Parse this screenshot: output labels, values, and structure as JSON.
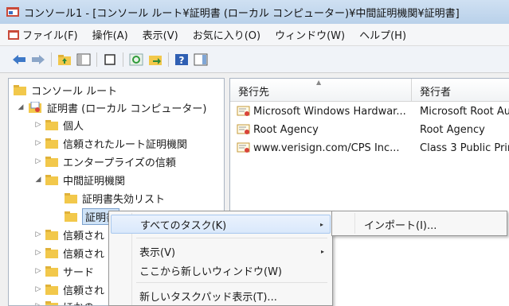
{
  "window": {
    "title": "コンソール1 - [コンソール ルート¥証明書 (ローカル コンピューター)¥中間証明機関¥証明書]"
  },
  "menubar": {
    "items": [
      "ファイル(F)",
      "操作(A)",
      "表示(V)",
      "お気に入り(O)",
      "ウィンドウ(W)",
      "ヘルプ(H)"
    ]
  },
  "toolbar": {
    "icons": [
      "back-arrow-icon",
      "forward-arrow-icon",
      "up-folder-icon",
      "show-hide-tree-icon",
      "new-window-icon",
      "refresh-icon",
      "export-list-icon",
      "help-icon",
      "action-pane-icon"
    ]
  },
  "tree": {
    "items": [
      {
        "label": "コンソール ルート"
      },
      {
        "label": "証明書 (ローカル コンピューター)"
      },
      {
        "label": "個人"
      },
      {
        "label": "信頼されたルート証明機関"
      },
      {
        "label": "エンタープライズの信頼"
      },
      {
        "label": "中間証明機関"
      },
      {
        "label": "証明書失効リスト"
      },
      {
        "label": "証明書"
      },
      {
        "label": "信頼され"
      },
      {
        "label": "信頼され"
      },
      {
        "label": "サード"
      },
      {
        "label": "信頼され"
      },
      {
        "label": "ほかの"
      }
    ]
  },
  "list": {
    "columns": [
      "発行先",
      "発行者"
    ],
    "rows": [
      {
        "issued_to": "Microsoft Windows Hardwar...",
        "issued_by": "Microsoft Root Au"
      },
      {
        "issued_to": "Root Agency",
        "issued_by": "Root Agency"
      },
      {
        "issued_to": "www.verisign.com/CPS Inc...",
        "issued_by": "Class 3 Public Prim"
      }
    ]
  },
  "context_menu": {
    "items": [
      {
        "label": "すべてのタスク(K)",
        "has_submenu": true
      },
      {
        "label": "表示(V)",
        "has_submenu": true
      },
      {
        "label": "ここから新しいウィンドウ(W)"
      },
      {
        "label": "新しいタスクパッド表示(T)..."
      }
    ],
    "submenu_indicator": "▸"
  },
  "submenu": {
    "items": [
      "インポート(I)..."
    ]
  },
  "colors": {
    "selection": "#cfe3f7",
    "folder": "#f2c84b",
    "titlebar": "#b9d1ea"
  }
}
